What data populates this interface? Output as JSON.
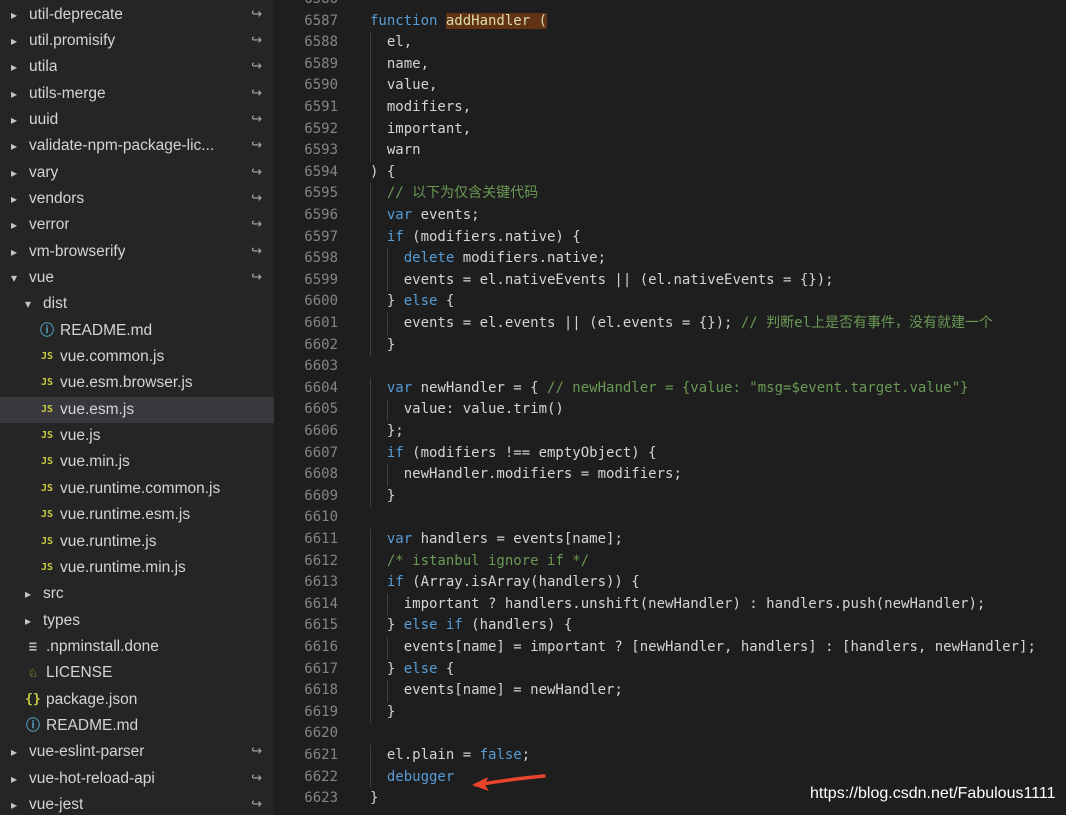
{
  "sidebar": {
    "items": [
      {
        "label": "util-deprecate",
        "depth": 0,
        "kind": "folder",
        "expanded": false,
        "symlink": true
      },
      {
        "label": "util.promisify",
        "depth": 0,
        "kind": "folder",
        "expanded": false,
        "symlink": true
      },
      {
        "label": "utila",
        "depth": 0,
        "kind": "folder",
        "expanded": false,
        "symlink": true
      },
      {
        "label": "utils-merge",
        "depth": 0,
        "kind": "folder",
        "expanded": false,
        "symlink": true
      },
      {
        "label": "uuid",
        "depth": 0,
        "kind": "folder",
        "expanded": false,
        "symlink": true
      },
      {
        "label": "validate-npm-package-lic...",
        "depth": 0,
        "kind": "folder",
        "expanded": false,
        "symlink": true
      },
      {
        "label": "vary",
        "depth": 0,
        "kind": "folder",
        "expanded": false,
        "symlink": true
      },
      {
        "label": "vendors",
        "depth": 0,
        "kind": "folder",
        "expanded": false,
        "symlink": true
      },
      {
        "label": "verror",
        "depth": 0,
        "kind": "folder",
        "expanded": false,
        "symlink": true
      },
      {
        "label": "vm-browserify",
        "depth": 0,
        "kind": "folder",
        "expanded": false,
        "symlink": true
      },
      {
        "label": "vue",
        "depth": 0,
        "kind": "folder",
        "expanded": true,
        "symlink": true
      },
      {
        "label": "dist",
        "depth": 1,
        "kind": "folder",
        "expanded": true,
        "symlink": false
      },
      {
        "label": "README.md",
        "depth": 2,
        "kind": "info",
        "symlink": false
      },
      {
        "label": "vue.common.js",
        "depth": 2,
        "kind": "js",
        "symlink": false
      },
      {
        "label": "vue.esm.browser.js",
        "depth": 2,
        "kind": "js",
        "symlink": false
      },
      {
        "label": "vue.esm.js",
        "depth": 2,
        "kind": "js",
        "symlink": false,
        "selected": true
      },
      {
        "label": "vue.js",
        "depth": 2,
        "kind": "js",
        "symlink": false
      },
      {
        "label": "vue.min.js",
        "depth": 2,
        "kind": "js",
        "symlink": false
      },
      {
        "label": "vue.runtime.common.js",
        "depth": 2,
        "kind": "js",
        "symlink": false
      },
      {
        "label": "vue.runtime.esm.js",
        "depth": 2,
        "kind": "js",
        "symlink": false
      },
      {
        "label": "vue.runtime.js",
        "depth": 2,
        "kind": "js",
        "symlink": false
      },
      {
        "label": "vue.runtime.min.js",
        "depth": 2,
        "kind": "js",
        "symlink": false
      },
      {
        "label": "src",
        "depth": 1,
        "kind": "folder",
        "expanded": false,
        "symlink": false
      },
      {
        "label": "types",
        "depth": 1,
        "kind": "folder",
        "expanded": false,
        "symlink": false
      },
      {
        "label": ".npminstall.done",
        "depth": 1,
        "kind": "npm",
        "symlink": false
      },
      {
        "label": "LICENSE",
        "depth": 1,
        "kind": "license",
        "symlink": false
      },
      {
        "label": "package.json",
        "depth": 1,
        "kind": "json",
        "symlink": false
      },
      {
        "label": "README.md",
        "depth": 1,
        "kind": "info",
        "symlink": false
      },
      {
        "label": "vue-eslint-parser",
        "depth": 0,
        "kind": "folder",
        "expanded": false,
        "symlink": true
      },
      {
        "label": "vue-hot-reload-api",
        "depth": 0,
        "kind": "folder",
        "expanded": false,
        "symlink": true
      },
      {
        "label": "vue-jest",
        "depth": 0,
        "kind": "folder",
        "expanded": false,
        "symlink": true
      }
    ]
  },
  "editor": {
    "lines": [
      {
        "n": "6586",
        "indent": 0,
        "tokens": []
      },
      {
        "n": "6587",
        "indent": 0,
        "tokens": [
          {
            "t": "kw",
            "v": "function "
          },
          {
            "t": "hl",
            "v": "addHandler ("
          }
        ]
      },
      {
        "n": "6588",
        "indent": 1,
        "tokens": [
          {
            "t": "p",
            "v": "el,"
          }
        ]
      },
      {
        "n": "6589",
        "indent": 1,
        "tokens": [
          {
            "t": "p",
            "v": "name,"
          }
        ]
      },
      {
        "n": "6590",
        "indent": 1,
        "tokens": [
          {
            "t": "p",
            "v": "value,"
          }
        ]
      },
      {
        "n": "6591",
        "indent": 1,
        "tokens": [
          {
            "t": "p",
            "v": "modifiers,"
          }
        ]
      },
      {
        "n": "6592",
        "indent": 1,
        "tokens": [
          {
            "t": "p",
            "v": "important,"
          }
        ]
      },
      {
        "n": "6593",
        "indent": 1,
        "tokens": [
          {
            "t": "p",
            "v": "warn"
          }
        ]
      },
      {
        "n": "6594",
        "indent": 0,
        "tokens": [
          {
            "t": "p",
            "v": ") {"
          }
        ]
      },
      {
        "n": "6595",
        "indent": 1,
        "tokens": [
          {
            "t": "cm",
            "v": "// 以下为仅含关键代码"
          }
        ]
      },
      {
        "n": "6596",
        "indent": 1,
        "tokens": [
          {
            "t": "kw",
            "v": "var"
          },
          {
            "t": "p",
            "v": " events;"
          }
        ]
      },
      {
        "n": "6597",
        "indent": 1,
        "tokens": [
          {
            "t": "kw",
            "v": "if"
          },
          {
            "t": "p",
            "v": " (modifiers.native) {"
          }
        ]
      },
      {
        "n": "6598",
        "indent": 2,
        "tokens": [
          {
            "t": "kw",
            "v": "delete"
          },
          {
            "t": "p",
            "v": " modifiers.native;"
          }
        ]
      },
      {
        "n": "6599",
        "indent": 2,
        "tokens": [
          {
            "t": "p",
            "v": "events = el.nativeEvents || (el.nativeEvents = {});"
          }
        ]
      },
      {
        "n": "6600",
        "indent": 1,
        "tokens": [
          {
            "t": "p",
            "v": "} "
          },
          {
            "t": "kw",
            "v": "else"
          },
          {
            "t": "p",
            "v": " {"
          }
        ]
      },
      {
        "n": "6601",
        "indent": 2,
        "tokens": [
          {
            "t": "p",
            "v": "events = el.events || (el.events = {}); "
          },
          {
            "t": "cm",
            "v": "// 判断el上是否有事件，没有就建一个"
          }
        ]
      },
      {
        "n": "6602",
        "indent": 1,
        "tokens": [
          {
            "t": "p",
            "v": "}"
          }
        ]
      },
      {
        "n": "6603",
        "indent": 0,
        "tokens": []
      },
      {
        "n": "6604",
        "indent": 1,
        "tokens": [
          {
            "t": "kw",
            "v": "var"
          },
          {
            "t": "p",
            "v": " newHandler = { "
          },
          {
            "t": "cm",
            "v": "// newHandler = {value: \"msg=$event.target.value\"}"
          }
        ]
      },
      {
        "n": "6605",
        "indent": 2,
        "tokens": [
          {
            "t": "p",
            "v": "value: value.trim()"
          }
        ]
      },
      {
        "n": "6606",
        "indent": 1,
        "tokens": [
          {
            "t": "p",
            "v": "};"
          }
        ]
      },
      {
        "n": "6607",
        "indent": 1,
        "tokens": [
          {
            "t": "kw",
            "v": "if"
          },
          {
            "t": "p",
            "v": " (modifiers !== emptyObject) {"
          }
        ]
      },
      {
        "n": "6608",
        "indent": 2,
        "tokens": [
          {
            "t": "p",
            "v": "newHandler.modifiers = modifiers;"
          }
        ]
      },
      {
        "n": "6609",
        "indent": 1,
        "tokens": [
          {
            "t": "p",
            "v": "}"
          }
        ]
      },
      {
        "n": "6610",
        "indent": 0,
        "tokens": []
      },
      {
        "n": "6611",
        "indent": 1,
        "tokens": [
          {
            "t": "kw",
            "v": "var"
          },
          {
            "t": "p",
            "v": " handlers = events[name];"
          }
        ]
      },
      {
        "n": "6612",
        "indent": 1,
        "tokens": [
          {
            "t": "cm",
            "v": "/* istanbul ignore if */"
          }
        ]
      },
      {
        "n": "6613",
        "indent": 1,
        "tokens": [
          {
            "t": "kw",
            "v": "if"
          },
          {
            "t": "p",
            "v": " (Array.isArray(handlers)) {"
          }
        ]
      },
      {
        "n": "6614",
        "indent": 2,
        "tokens": [
          {
            "t": "p",
            "v": "important ? handlers.unshift(newHandler) : handlers.push(newHandler);"
          }
        ]
      },
      {
        "n": "6615",
        "indent": 1,
        "tokens": [
          {
            "t": "p",
            "v": "} "
          },
          {
            "t": "kw",
            "v": "else if"
          },
          {
            "t": "p",
            "v": " (handlers) {"
          }
        ]
      },
      {
        "n": "6616",
        "indent": 2,
        "tokens": [
          {
            "t": "p",
            "v": "events[name] = important ? [newHandler, handlers] : [handlers, newHandler];"
          }
        ]
      },
      {
        "n": "6617",
        "indent": 1,
        "tokens": [
          {
            "t": "p",
            "v": "} "
          },
          {
            "t": "kw",
            "v": "else"
          },
          {
            "t": "p",
            "v": " {"
          }
        ]
      },
      {
        "n": "6618",
        "indent": 2,
        "tokens": [
          {
            "t": "p",
            "v": "events[name] = newHandler;"
          }
        ]
      },
      {
        "n": "6619",
        "indent": 1,
        "tokens": [
          {
            "t": "p",
            "v": "}"
          }
        ]
      },
      {
        "n": "6620",
        "indent": 0,
        "tokens": []
      },
      {
        "n": "6621",
        "indent": 1,
        "tokens": [
          {
            "t": "p",
            "v": "el.plain = "
          },
          {
            "t": "kw",
            "v": "false"
          },
          {
            "t": "p",
            "v": ";"
          }
        ]
      },
      {
        "n": "6622",
        "indent": 1,
        "tokens": [
          {
            "t": "kw",
            "v": "debugger"
          }
        ]
      },
      {
        "n": "6623",
        "indent": 0,
        "tokens": [
          {
            "t": "p",
            "v": "}"
          }
        ]
      }
    ]
  },
  "watermark": "https://blog.csdn.net/Fabulous1111",
  "colors": {
    "sidebar_bg": "#252526",
    "editor_bg": "#1e1e1e",
    "selected_row": "#37373d",
    "keyword": "#569cd6",
    "comment": "#6a9955",
    "function_highlight": "#613214",
    "arrow": "#e8452c"
  }
}
